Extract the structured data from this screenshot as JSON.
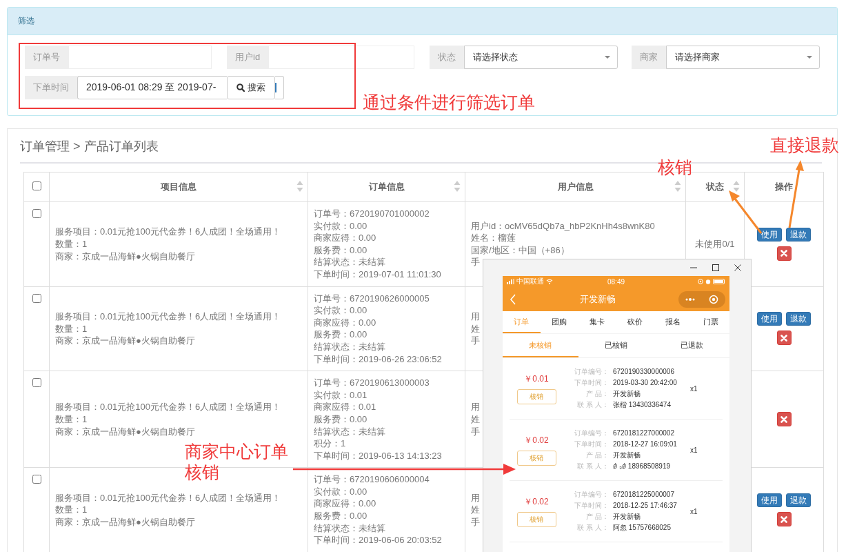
{
  "filter_panel": {
    "title": "筛选",
    "fields": [
      {
        "kind": "text",
        "label": "订单号"
      },
      {
        "kind": "text",
        "label": "用户id"
      },
      {
        "kind": "select",
        "label": "状态",
        "value": "请选择状态"
      },
      {
        "kind": "select",
        "label": "商家",
        "value": "请选择商家"
      },
      {
        "kind": "daterange",
        "label": "下单时间",
        "value": "2019-06-01 08:29 至 2019-07-"
      }
    ],
    "search_button": "搜索"
  },
  "breadcrumb": "订单管理 > 产品订单列表",
  "table": {
    "columns": [
      {
        "kind": "checkbox",
        "checked": false
      },
      {
        "kind": "text",
        "label": "项目信息",
        "sortable": true
      },
      {
        "kind": "text",
        "label": "订单信息",
        "sortable": true
      },
      {
        "kind": "text",
        "label": "用户信息",
        "sortable": true
      },
      {
        "kind": "text",
        "label": "状态",
        "sortable": true
      },
      {
        "kind": "text",
        "label": "操作",
        "sortable": false
      }
    ],
    "rows": [
      {
        "checked": false,
        "item_info": [
          "服务项目：0.01元抢100元代金券！6人成团！全场通用！",
          "数量：1",
          "商家：京成一品海鲜●火锅自助餐厅"
        ],
        "order_info": [
          "订单号：6720190701000002",
          "实付款：0.00",
          "商家应得：0.00",
          "服务费：0.00",
          "结算状态：未结算",
          "下单时间：2019-07-01 11:01:30"
        ],
        "user_info": [
          "用户id：ocMV65dQb7a_hbP2KnHh4s8wnK80",
          "姓名：榴莲",
          "国家/地区：中国（+86）",
          "手"
        ],
        "status": "未使用0/1",
        "actions": [
          {
            "kind": "primary",
            "label": "使用"
          },
          {
            "kind": "primary",
            "label": "退款"
          },
          {
            "kind": "delete"
          }
        ]
      },
      {
        "checked": false,
        "item_info": [
          "服务项目：0.01元抢100元代金券！6人成团！全场通用！",
          "数量：1",
          "商家：京成一品海鲜●火锅自助餐厅"
        ],
        "order_info": [
          "订单号：6720190626000005",
          "实付款：0.00",
          "商家应得：0.00",
          "服务费：0.00",
          "结算状态：未结算",
          "下单时间：2019-06-26 23:06:52"
        ],
        "user_info": [
          "用",
          "姓",
          "手"
        ],
        "actions": [
          {
            "kind": "primary",
            "label": "使用"
          },
          {
            "kind": "primary",
            "label": "退款"
          },
          {
            "kind": "delete"
          }
        ]
      },
      {
        "checked": false,
        "item_info": [
          "服务项目：0.01元抢100元代金券！6人成团！全场通用！",
          "数量：1",
          "商家：京成一品海鲜●火锅自助餐厅"
        ],
        "order_info": [
          "订单号：6720190613000003",
          "实付款：0.01",
          "商家应得：0.01",
          "服务费：0.00",
          "结算状态：未结算",
          "积分：1",
          "下单时间：2019-06-13 14:13:23"
        ],
        "user_info": [
          "用",
          "姓",
          "手"
        ],
        "actions": [
          {
            "kind": "delete"
          }
        ]
      },
      {
        "checked": false,
        "item_info": [
          "服务项目：0.01元抢100元代金券！6人成团！全场通用！",
          "数量：1",
          "商家：京成一品海鲜●火锅自助餐厅"
        ],
        "order_info": [
          "订单号：6720190606000004",
          "实付款：0.00",
          "商家应得：0.00",
          "服务费：0.00",
          "结算状态：未结算",
          "下单时间：2019-06-06 20:03:52"
        ],
        "user_info": [
          "用",
          "姓",
          "手"
        ],
        "actions": [
          {
            "kind": "primary",
            "label": "使用"
          },
          {
            "kind": "primary",
            "label": "退款"
          },
          {
            "kind": "delete"
          }
        ]
      }
    ]
  },
  "phone": {
    "carrier": "中国联通",
    "time": "08:49",
    "title": "开发新畅",
    "tabs": [
      {
        "label": "订单",
        "selected": true
      },
      {
        "label": "团购",
        "selected": false
      },
      {
        "label": "集卡",
        "selected": false
      },
      {
        "label": "砍价",
        "selected": false
      },
      {
        "label": "报名",
        "selected": false
      },
      {
        "label": "门票",
        "selected": false
      }
    ],
    "subtabs": [
      {
        "label": "未核销",
        "selected": true
      },
      {
        "label": "已核销",
        "selected": false
      },
      {
        "label": "已退款",
        "selected": false
      }
    ],
    "orders": [
      {
        "price": "￥0.01",
        "button": "核销",
        "quantity": "x1",
        "fields": [
          {
            "label": "订单编号：",
            "value": "6720190330000006"
          },
          {
            "label": "下单时间：",
            "value": "2019-03-30 20:42:00"
          },
          {
            "label": "产 品：",
            "value": "开发新畅"
          },
          {
            "label": "联 系 人：",
            "value": "张楷 13430336474"
          }
        ]
      },
      {
        "price": "￥0.02",
        "button": "核销",
        "quantity": "x1",
        "fields": [
          {
            "label": "订单编号：",
            "value": "6720181227000002"
          },
          {
            "label": "下单时间：",
            "value": "2018-12-27 16:09:01"
          },
          {
            "label": "产 品：",
            "value": "开发新畅"
          },
          {
            "label": "联 系 人：",
            "value": "ǿ ₃ǿ 18968508919"
          }
        ]
      },
      {
        "price": "￥0.02",
        "button": "核销",
        "quantity": "x1",
        "fields": [
          {
            "label": "订单编号：",
            "value": "6720181225000007"
          },
          {
            "label": "下单时间：",
            "value": "2018-12-25 17:46:37"
          },
          {
            "label": "产 品：",
            "value": "开发新畅"
          },
          {
            "label": "联 系 人：",
            "value": "阿忽 15757668025"
          }
        ]
      }
    ]
  },
  "annotations": [
    {
      "text": "通过条件进行筛选订单"
    },
    {
      "text": "核销"
    },
    {
      "text": "直接退款"
    },
    {
      "text": "商家中心订单"
    },
    {
      "text": "核销"
    }
  ]
}
